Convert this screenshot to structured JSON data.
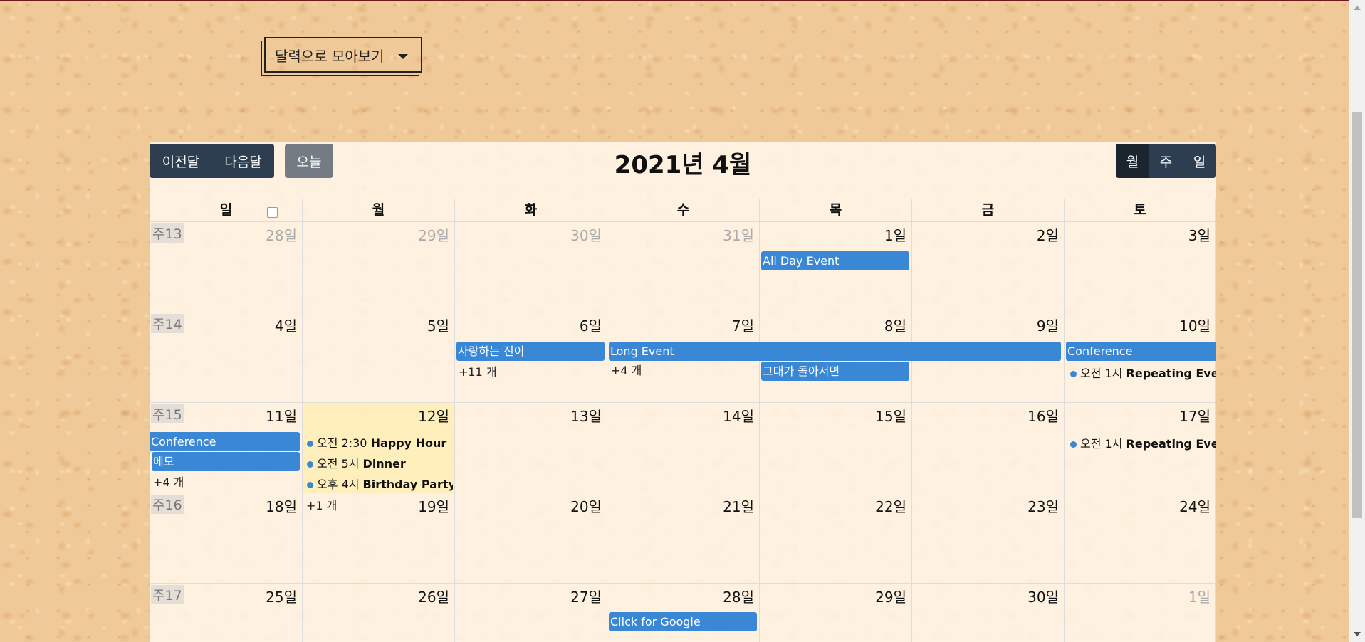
{
  "view_select": {
    "label": "달력으로 모아보기"
  },
  "toolbar": {
    "prev": "이전달",
    "next": "다음달",
    "today": "오늘",
    "title": "2021년 4월",
    "views": [
      "월",
      "주",
      "일"
    ]
  },
  "weekdays": [
    "일",
    "월",
    "화",
    "수",
    "목",
    "금",
    "토"
  ],
  "weeks": [
    {
      "week": "주13",
      "days": [
        "28일",
        "29일",
        "30일",
        "31일",
        "1일",
        "2일",
        "3일"
      ]
    },
    {
      "week": "주14",
      "days": [
        "4일",
        "5일",
        "6일",
        "7일",
        "8일",
        "9일",
        "10일"
      ]
    },
    {
      "week": "주15",
      "days": [
        "11일",
        "12일",
        "13일",
        "14일",
        "15일",
        "16일",
        "17일"
      ]
    },
    {
      "week": "주16",
      "days": [
        "18일",
        "19일",
        "20일",
        "21일",
        "22일",
        "23일",
        "24일"
      ]
    },
    {
      "week": "주17",
      "days": [
        "25일",
        "26일",
        "27일",
        "28일",
        "29일",
        "30일",
        "1일"
      ]
    }
  ],
  "events": {
    "all_day": "All Day Event",
    "love_jin": "사랑하는 진이",
    "long_event": "Long Event",
    "conference": "Conference",
    "turn_away": "그대가 돌아서면",
    "memo": "메모",
    "google": "Click for Google",
    "more_11": "+11 개",
    "more_4a": "+4 개",
    "more_4b": "+4 개",
    "more_1": "+1 개",
    "repeat_time": "오전 1시",
    "repeat_title": "Repeating Event",
    "happy_time": "오전 2:30",
    "happy_title": "Happy Hour",
    "dinner_time": "오전 5시",
    "dinner_title": "Dinner",
    "bday_time": "오후 4시",
    "bday_title": "Birthday Party"
  },
  "colors": {
    "event": "#3a87d6",
    "button": "#2c3e50",
    "today_bg": "#fff3c4"
  }
}
